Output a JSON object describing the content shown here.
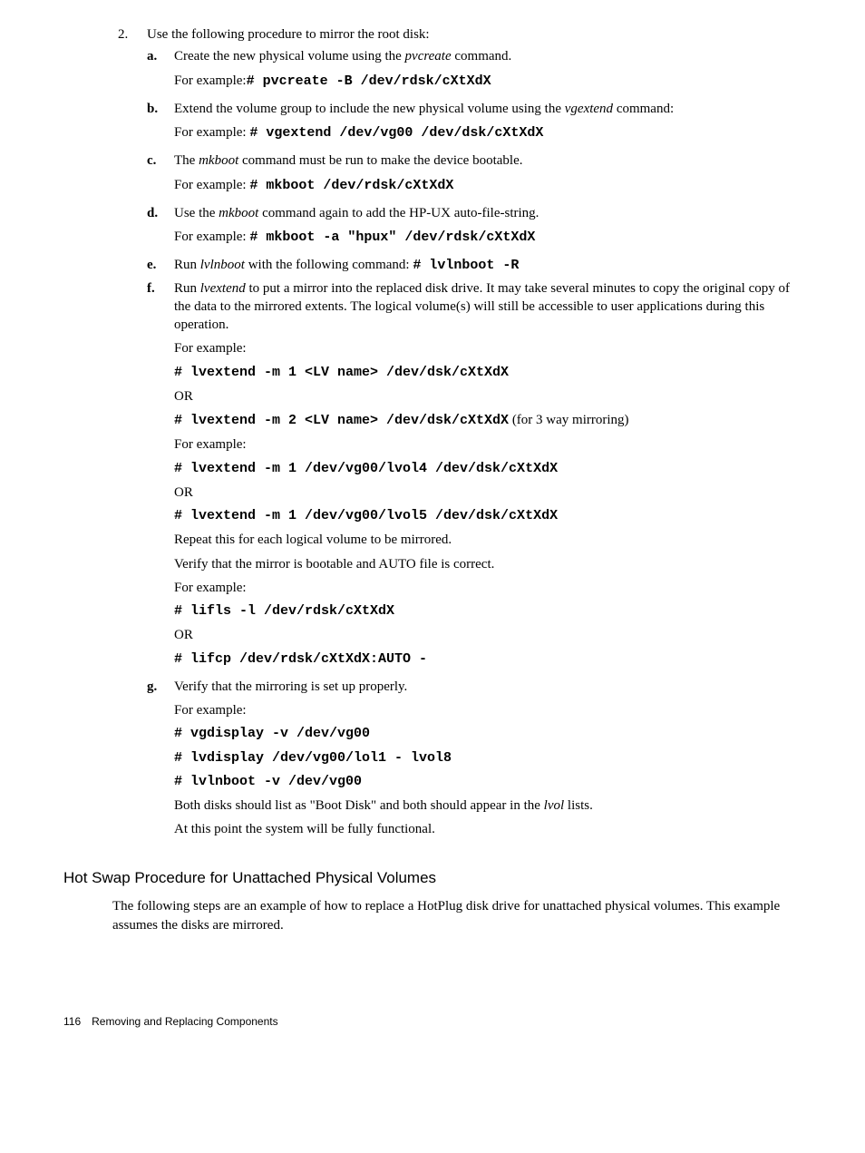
{
  "step2": {
    "number": "2.",
    "intro": "Use the following procedure to mirror the root disk:",
    "a": {
      "label": "a.",
      "l1a": "Create the new physical volume using the ",
      "l1b": "pvcreate",
      "l1c": " command.",
      "l2a": "For example:",
      "l2b": "# pvcreate -B /dev/rdsk/cXtXdX"
    },
    "b": {
      "label": "b.",
      "l1a": "Extend the volume group to include the new physical volume using the ",
      "l1b": "vgextend",
      "l1c": " command:",
      "l2a": "For example: ",
      "l2b": "# vgextend /dev/vg00 /dev/dsk/cXtXdX"
    },
    "c": {
      "label": "c.",
      "l1a": "The ",
      "l1b": "mkboot",
      "l1c": " command must be run to make the device bootable.",
      "l2a": "For example: ",
      "l2b": "# mkboot /dev/rdsk/cXtXdX"
    },
    "d": {
      "label": "d.",
      "l1a": "Use the ",
      "l1b": "mkboot",
      "l1c": " command again to add the HP-UX auto-file-string.",
      "l2a": "For example: ",
      "l2b": "# mkboot -a \"hpux\" /dev/rdsk/cXtXdX"
    },
    "e": {
      "label": "e.",
      "l1a": "Run ",
      "l1b": "lvlnboot",
      "l1c": " with the following command: ",
      "l1d": "# lvlnboot -R"
    },
    "f": {
      "label": "f.",
      "l1a": "Run ",
      "l1b": "lvextend",
      "l1c": " to put a mirror into the replaced disk drive. It may take several minutes to copy the original copy of the data to the mirrored extents. The logical volume(s) will still be accessible to user applications during this operation.",
      "l2": "For example:",
      "l3": "# lvextend -m 1 <LV name> /dev/dsk/cXtXdX",
      "l4": "OR",
      "l5a": "# lvextend -m 2 <LV name> /dev/dsk/cXtXdX",
      "l5b": " (for 3 way mirroring)",
      "l6": "For example:",
      "l7": "# lvextend -m 1 /dev/vg00/lvol4 /dev/dsk/cXtXdX",
      "l8": "OR",
      "l9": "# lvextend -m 1 /dev/vg00/lvol5 /dev/dsk/cXtXdX",
      "l10": "Repeat this for each logical volume to be mirrored.",
      "l11": "Verify that the mirror is bootable and AUTO file is correct.",
      "l12": "For example:",
      "l13": "# lifls -l /dev/rdsk/cXtXdX",
      "l14": "OR",
      "l15": "# lifcp /dev/rdsk/cXtXdX:AUTO -"
    },
    "g": {
      "label": "g.",
      "l1": "Verify that the mirroring is set up properly.",
      "l2": "For example:",
      "l3": "# vgdisplay -v /dev/vg00",
      "l4": "# lvdisplay /dev/vg00/lol1 - lvol8",
      "l5": "# lvlnboot -v /dev/vg00",
      "l6a": "Both disks should list as \"Boot Disk\" and both should appear in the ",
      "l6b": "lvol",
      "l6c": " lists.",
      "l7": "At this point the system will be fully functional."
    }
  },
  "section_heading": "Hot Swap Procedure for Unattached Physical Volumes",
  "section_para": "The following steps are an example of how to replace a HotPlug disk drive for unattached physical volumes. This example assumes the disks are mirrored.",
  "footer": {
    "page_number": "116",
    "chapter": "Removing and Replacing Components"
  }
}
